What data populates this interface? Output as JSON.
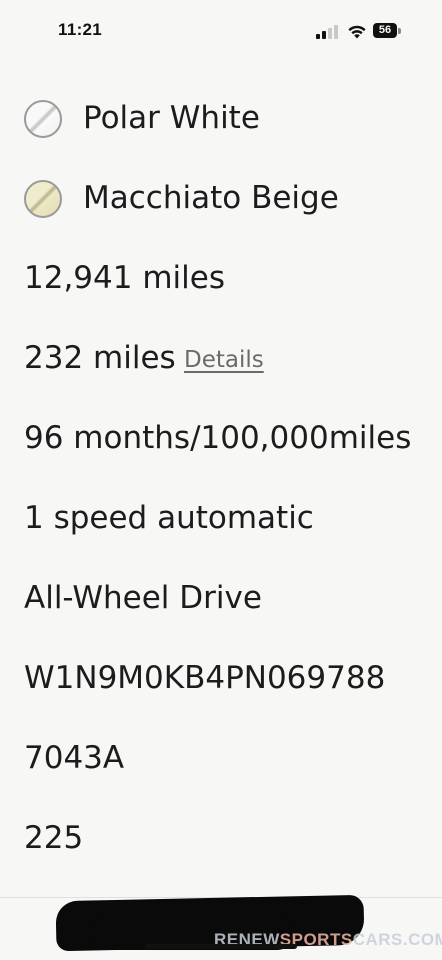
{
  "status_bar": {
    "time": "11:21",
    "battery_level": "56",
    "signal_bars_active": 2,
    "signal_bars_total": 4
  },
  "colors": {
    "exterior": {
      "label": "Polar White",
      "swatch": "#f5f5f5"
    },
    "interior": {
      "label": "Macchiato Beige",
      "swatch": "#ebe7c1"
    }
  },
  "specs": {
    "mileage": "12,941 miles",
    "range": "232 miles",
    "range_details_link": "Details",
    "warranty": "96 months/100,000miles",
    "transmission": "1 speed automatic",
    "drivetrain": "All-Wheel Drive",
    "vin": "W1N9M0KB4PN069788",
    "stock_number": "7043A",
    "value_225": "225"
  },
  "watermark": {
    "part1": "RENEW",
    "part2": "SPORTS",
    "part3": "CARS.COM",
    "color1": "#c9cfd8",
    "color2": "#f2b7a4",
    "color3": "#c9cfd8"
  }
}
